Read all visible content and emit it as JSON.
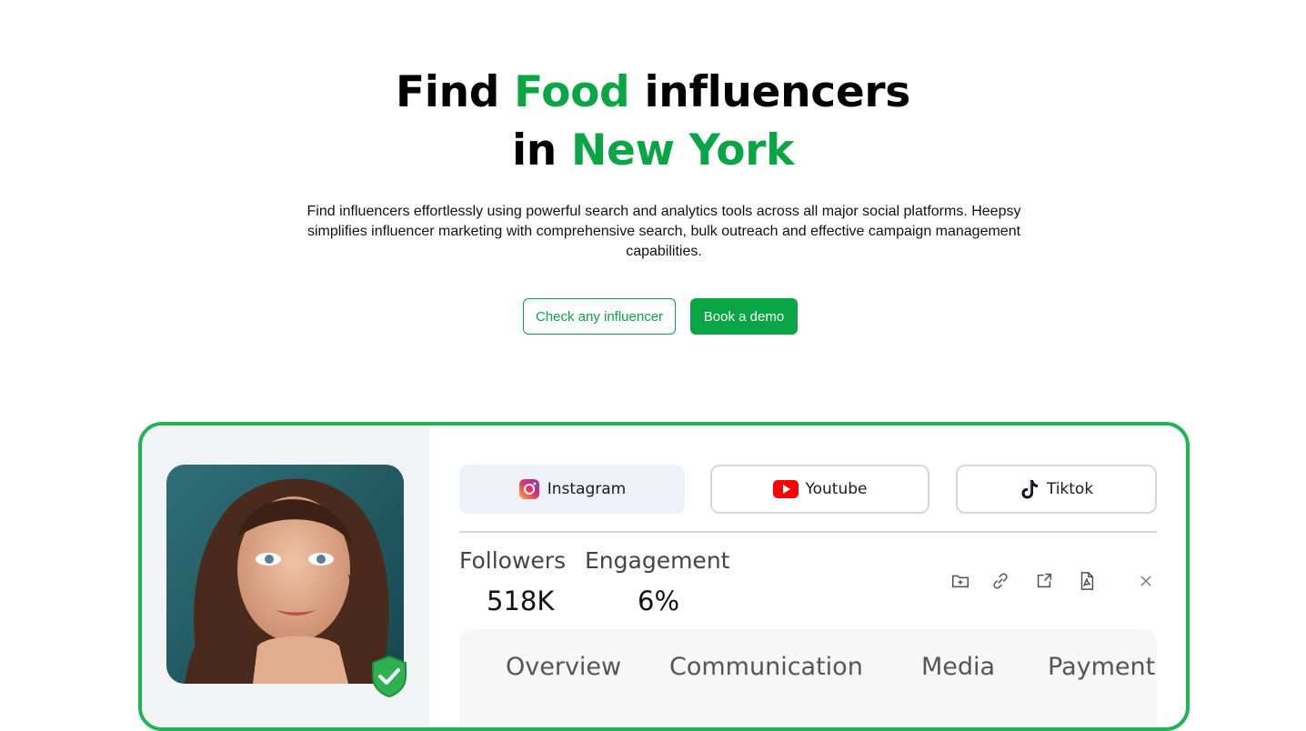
{
  "hero": {
    "title_line1_pre": "Find ",
    "title_line1_highlight": "Food",
    "title_line1_post": " influencers",
    "title_line2_pre": "in ",
    "title_line2_highlight": "New York",
    "description": "Find influencers effortlessly using powerful search and analytics tools across all major social platforms. Heepsy simplifies influencer marketing with comprehensive search, bulk outreach and effective campaign management capabilities.",
    "check_button": "Check any influencer",
    "demo_button": "Book a demo"
  },
  "profile": {
    "platform_tabs": [
      {
        "label": "Instagram",
        "icon": "instagram-icon",
        "selected": true
      },
      {
        "label": "Youtube",
        "icon": "youtube-icon",
        "selected": false
      },
      {
        "label": "Tiktok",
        "icon": "tiktok-icon",
        "selected": false
      }
    ],
    "stats": {
      "followers_label": "Followers",
      "followers_value": "518K",
      "engagement_label": "Engagement",
      "engagement_value": "6%"
    },
    "tools": [
      "folder-add-icon",
      "link-icon",
      "external-link-icon",
      "pdf-icon",
      "close-icon"
    ],
    "sections": [
      "Overview",
      "Communication",
      "Media",
      "Payment"
    ]
  },
  "colors": {
    "brand_green": "#0aa544",
    "card_border": "#20b454"
  }
}
